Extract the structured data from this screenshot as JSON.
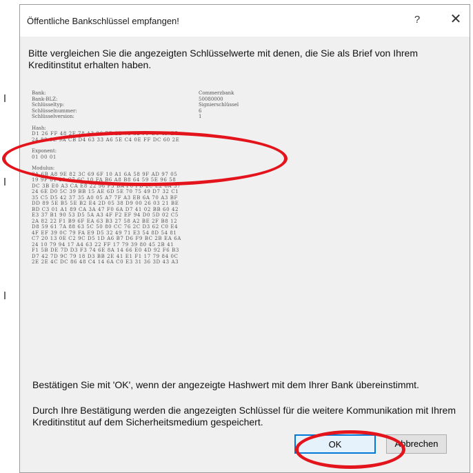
{
  "dialog": {
    "title": "Öffentliche Bankschlüssel empfangen!",
    "help_label": "?",
    "close_label": "✕"
  },
  "intro": "Bitte vergleichen Sie die angezeigten Schlüsselwerte mit denen, die Sie als Brief von Ihrem Kreditinstitut erhalten haben.",
  "key_info": [
    {
      "key": "Bank:",
      "value": "Commerzbank"
    },
    {
      "key": "Bank-BLZ:",
      "value": "50080000"
    },
    {
      "key": "Schlüsseltyp:",
      "value": "Signierschlüssel"
    },
    {
      "key": "Schlüsselnummer:",
      "value": "6"
    },
    {
      "key": "Schlüsselversion:",
      "value": "1"
    }
  ],
  "hash": {
    "label": "Hash:",
    "lines": [
      "D1 26 FF 48 2F 78 A3 86 BB 2B 73 32 FF D5 4F E7",
      "24 88 0E 9A CB D4 63 33 A6 5E C4 0E FF DC 60 2E"
    ]
  },
  "exponent": {
    "label": "Exponent:",
    "lines": [
      "01 00 01"
    ]
  },
  "modulus": {
    "label": "Modulus:",
    "lines": [
      "8A 6B A8 9E 82 3C 69 6F 10 A1 6A 58 9F AD 97 05",
      "19 9F 81 29 C7 6C 10 FA B6 A8 B8 64 59 5E 96 58",
      "DC 3B E0 A3 CA E8 22 96 F3 BA F0 FD 2C E2 6A 37",
      "24 6E D0 5C 39 BB 15 AE 6D 5E 70 75 49 D7 32 C1",
      "35 C5 D5 42 37 35 A0 05 A7 7F A3 EB 6A 70 A3 BF",
      "DD 89 5E B5 5E B2 E4 2D 05 38 D9 00 26 03 21 BE",
      "BD C3 01 A1 89 CA 3A 47 F0 6A D7 41 02 BB 60 42",
      "E3 37 B1 90 53 D5 5A A3 4F F2 EF 94 D0 5D 02 C5",
      "2A 82 22 F1 B9 6F EA 63 B3 27 58 A2 BE 2F B8 12",
      "D8 59 61 7A 88 63 5C 50 80 CC 76 2C D3 62 C0 E4",
      "4F EF 39 0C 79 FA E9 D5 32 49 71 E3 54 8D 54 81",
      "C7 20 13 0E C2 9C D5 1D A6 B7 D6 F9 BC 2B EA 6A",
      "24 10 79 94 17 A4 63 22 FF 17 79 39 80 45 2B 41",
      "F1 5B DE 7D D3 F3 74 6E 8A 14 66 E0 4D 92 F6 B3",
      "D7 42 7D 9C 79 18 D3 BB 2E 41 E1 F1 17 79 84 0C",
      "2E 2E 4C DC 86 48 C4 14 6A C0 E3 31 36 3D 43 A3"
    ]
  },
  "confirm_text": "Bestätigen Sie mit 'OK', wenn der angezeigte Hashwert mit dem Ihrer Bank übereinstimmt.",
  "store_text": "Durch Ihre Bestätigung werden die angezeigten Schlüssel für die weitere Kommunikation mit Ihrem Kreditinstitut auf dem Sicherheitsmedium gespeichert.",
  "buttons": {
    "ok": "OK",
    "cancel": "Abbrechen"
  },
  "colors": {
    "annotation": "#e3141b",
    "ok_border": "#0078d7"
  }
}
